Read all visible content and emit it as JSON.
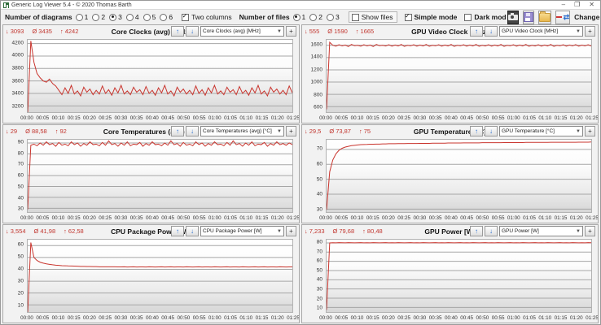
{
  "window": {
    "title": "Generic Log Viewer 5.4 -  © 2020 Thomas Barth",
    "controls": {
      "minimize": "–",
      "maximize": "❐",
      "close": "✕"
    }
  },
  "icons": {
    "up_arrow": "↑",
    "down_arrow": "↓",
    "dropdown_arrow": "▼",
    "plus": "+",
    "min_marker": "↓",
    "avg_marker": "Ø",
    "max_marker": "↑",
    "swap_arrows": "⇄"
  },
  "accent": {
    "line_red": "#c9352e",
    "stat_red": "#c2362f",
    "arrow_blue": "#2e6fce"
  },
  "toolbar": {
    "diagrams_label": "Number of diagrams",
    "diagrams_options": [
      "1",
      "2",
      "3",
      "4",
      "5",
      "6"
    ],
    "diagrams_selected": "3",
    "two_columns_label": "Two columns",
    "two_columns_checked": true,
    "files_label": "Number of files",
    "files_options": [
      "1",
      "2",
      "3"
    ],
    "files_selected": "1",
    "show_files_label": "Show files",
    "show_files_checked": false,
    "simple_mode_label": "Simple mode",
    "simple_mode_checked": true,
    "dark_mode_label": "Dark mod",
    "dark_mode_checked": false,
    "change_all_label": "Change all"
  },
  "x_ticks": [
    "00:00",
    "00:05",
    "00:10",
    "00:15",
    "00:20",
    "00:25",
    "00:30",
    "00:35",
    "00:40",
    "00:45",
    "00:50",
    "00:55",
    "01:00",
    "01:05",
    "01:10",
    "01:15",
    "01:20",
    "01:25"
  ],
  "chart_data": [
    {
      "type": "line",
      "title": "Core Clocks (avg) [MHz]",
      "selector": "Core Clocks (avg) [MHz]",
      "stats": {
        "min": "3093",
        "avg": "3435",
        "max": "4242"
      },
      "ylim": [
        3100,
        4260
      ],
      "yticks": [
        3200,
        3400,
        3600,
        3800,
        4000,
        4200
      ],
      "x_minutes_step": 1,
      "values": [
        3093,
        4242,
        3900,
        3720,
        3650,
        3600,
        3580,
        3630,
        3560,
        3520,
        3450,
        3380,
        3490,
        3400,
        3530,
        3390,
        3440,
        3360,
        3500,
        3420,
        3470,
        3380,
        3450,
        3390,
        3520,
        3400,
        3460,
        3370,
        3490,
        3410,
        3530,
        3390,
        3440,
        3380,
        3500,
        3420,
        3460,
        3380,
        3510,
        3400,
        3450,
        3370,
        3490,
        3410,
        3530,
        3390,
        3440,
        3360,
        3500,
        3420,
        3470,
        3390,
        3450,
        3380,
        3520,
        3400,
        3460,
        3370,
        3490,
        3410,
        3530,
        3390,
        3440,
        3380,
        3500,
        3420,
        3460,
        3380,
        3510,
        3400,
        3450,
        3370,
        3490,
        3410,
        3530,
        3390,
        3440,
        3360,
        3500,
        3420,
        3470,
        3390,
        3450,
        3380,
        3520,
        3410
      ]
    },
    {
      "type": "line",
      "title": "GPU Video Clock [MHz]",
      "selector": "GPU Video Clock [MHz]",
      "stats": {
        "min": "555",
        "avg": "1590",
        "max": "1665"
      },
      "ylim": [
        510,
        1690
      ],
      "yticks": [
        600,
        800,
        1000,
        1200,
        1400,
        1600
      ],
      "x_minutes_step": 1,
      "values": [
        555,
        1650,
        1600,
        1585,
        1610,
        1590,
        1605,
        1580,
        1615,
        1595,
        1600,
        1585,
        1610,
        1590,
        1605,
        1580,
        1615,
        1595,
        1600,
        1588,
        1610,
        1585,
        1605,
        1590,
        1615,
        1582,
        1600,
        1592,
        1610,
        1586,
        1605,
        1590,
        1615,
        1584,
        1600,
        1592,
        1610,
        1586,
        1605,
        1590,
        1615,
        1582,
        1600,
        1592,
        1610,
        1585,
        1605,
        1590,
        1615,
        1584,
        1600,
        1588,
        1610,
        1586,
        1605,
        1590,
        1615,
        1582,
        1600,
        1592,
        1610,
        1585,
        1605,
        1590,
        1615,
        1584,
        1600,
        1588,
        1610,
        1586,
        1605,
        1590,
        1615,
        1582,
        1600,
        1592,
        1610,
        1585,
        1605,
        1590,
        1612,
        1586,
        1604,
        1590,
        1610,
        1588
      ]
    },
    {
      "type": "line",
      "title": "Core Temperatures (avg) [°C]",
      "selector": "Core Temperatures (avg) [°C]",
      "stats": {
        "min": "29",
        "avg": "88,58",
        "max": "92"
      },
      "ylim": [
        26.5,
        93
      ],
      "yticks": [
        30,
        40,
        50,
        60,
        70,
        80,
        90
      ],
      "x_minutes_step": 1,
      "values": [
        29,
        88,
        89,
        87.5,
        90,
        88,
        91,
        88.5,
        89.5,
        87,
        90.5,
        88,
        89,
        87.5,
        91,
        88.5,
        90,
        87,
        89.5,
        88,
        91,
        88.5,
        89,
        87.5,
        90.5,
        88,
        92,
        88.5,
        89.5,
        87,
        90,
        88,
        91,
        87.5,
        89,
        88.5,
        90.5,
        87,
        89.5,
        88,
        91,
        88.5,
        89,
        87.5,
        90,
        88,
        92,
        88.5,
        89.5,
        87,
        90.5,
        88,
        89,
        87.5,
        91,
        88.5,
        90,
        87,
        89.5,
        88,
        91,
        88.5,
        89,
        87.5,
        90.5,
        88,
        92,
        88.5,
        89.5,
        87,
        90,
        88,
        91,
        87.5,
        89,
        88.5,
        90.5,
        87,
        89.5,
        88,
        91,
        88.5,
        89.5,
        88,
        90,
        88.5
      ]
    },
    {
      "type": "line",
      "title": "GPU Temperature [°C]",
      "selector": "GPU Temperature [°C]",
      "stats": {
        "min": "29,5",
        "avg": "73,87",
        "max": "75"
      },
      "ylim": [
        28,
        76.5
      ],
      "yticks": [
        30,
        40,
        50,
        60,
        70
      ],
      "x_minutes_step": 1,
      "values": [
        29.5,
        55,
        63,
        67,
        69.5,
        70.8,
        71.6,
        72.1,
        72.5,
        72.8,
        73,
        73.2,
        73.3,
        73.4,
        73.5,
        73.5,
        73.6,
        73.6,
        73.7,
        73.7,
        73.8,
        73.8,
        73.8,
        73.9,
        73.9,
        73.9,
        74,
        74,
        74,
        74,
        74.1,
        74.1,
        74.1,
        74.1,
        74.2,
        74.2,
        74.2,
        74.2,
        74.2,
        74.3,
        74.3,
        74.3,
        74.3,
        74.3,
        74.4,
        74.4,
        74.4,
        74.4,
        74.4,
        74.4,
        74.5,
        74.5,
        74.5,
        74.5,
        74.5,
        74.5,
        74.5,
        74.6,
        74.6,
        74.6,
        74.6,
        74.6,
        74.6,
        74.6,
        74.7,
        74.7,
        74.7,
        74.7,
        74.7,
        74.7,
        74.7,
        74.7,
        74.8,
        74.8,
        74.8,
        74.8,
        74.8,
        74.8,
        74.8,
        74.8,
        74.8,
        74.9,
        74.9,
        74.9,
        74.9,
        75
      ]
    },
    {
      "type": "line",
      "title": "CPU Package Power [W]",
      "selector": "CPU Package Power [W]",
      "stats": {
        "min": "3,554",
        "avg": "41,98",
        "max": "62,58"
      },
      "ylim": [
        4,
        65
      ],
      "yticks": [
        10,
        20,
        30,
        40,
        50,
        60
      ],
      "x_minutes_step": 1,
      "values": [
        3.554,
        62.58,
        50,
        47.5,
        46,
        45.2,
        44.6,
        44.2,
        43.8,
        43.5,
        43.3,
        43.1,
        43,
        42.9,
        42.8,
        42.7,
        42.6,
        42.5,
        42.5,
        42.4,
        42.4,
        42.3,
        42.3,
        42.2,
        42.2,
        42.2,
        42.1,
        42.1,
        42.1,
        42,
        42,
        42.1,
        41.9,
        42,
        42.1,
        41.9,
        42,
        42,
        41.9,
        42.1,
        42,
        41.9,
        42,
        42.1,
        41.9,
        42,
        42.1,
        41.9,
        42,
        42,
        41.9,
        42.1,
        42,
        41.9,
        42,
        42.1,
        41.9,
        42,
        42,
        41.9,
        42.1,
        42,
        41.9,
        42,
        42.1,
        41.9,
        42,
        42,
        41.9,
        42.1,
        42,
        41.9,
        42,
        42.1,
        41.9,
        42,
        42.1,
        41.9,
        42,
        42,
        41.9,
        42.1,
        42,
        41.9,
        42,
        42
      ]
    },
    {
      "type": "line",
      "title": "GPU Power [W]",
      "selector": "GPU Power [W]",
      "stats": {
        "min": "7,233",
        "avg": "79,68",
        "max": "80,48"
      },
      "ylim": [
        5,
        83.5
      ],
      "yticks": [
        10,
        20,
        30,
        40,
        50,
        60,
        70,
        80
      ],
      "x_minutes_step": 1,
      "values": [
        7.233,
        80,
        80.2,
        80.1,
        80.3,
        80.2,
        80.1,
        80.3,
        80.2,
        80.1,
        80.2,
        80.3,
        80.1,
        80.2,
        80.1,
        80.3,
        80.2,
        80.1,
        80.2,
        80.3,
        80.1,
        80.2,
        80.1,
        80.3,
        80.2,
        80.1,
        80.2,
        80.3,
        80.1,
        80.2,
        80.1,
        80.3,
        80.2,
        80.1,
        80.2,
        80.3,
        80.1,
        80.2,
        80.1,
        80.3,
        80.2,
        80.1,
        80.2,
        80.3,
        80.1,
        80.2,
        80.1,
        80.3,
        80.2,
        80.1,
        80.2,
        80.3,
        80.1,
        80.2,
        80.1,
        80.3,
        80.2,
        80.1,
        80.2,
        80.3,
        80.1,
        80.2,
        80.1,
        80.3,
        80.2,
        80.1,
        80.2,
        80.3,
        80.1,
        80.2,
        80.1,
        80.3,
        80.2,
        80.1,
        80.2,
        80.3,
        80.1,
        80.2,
        80.1,
        80.3,
        80.2,
        80.1,
        80.2,
        80.1,
        80.3,
        80.2
      ]
    }
  ]
}
